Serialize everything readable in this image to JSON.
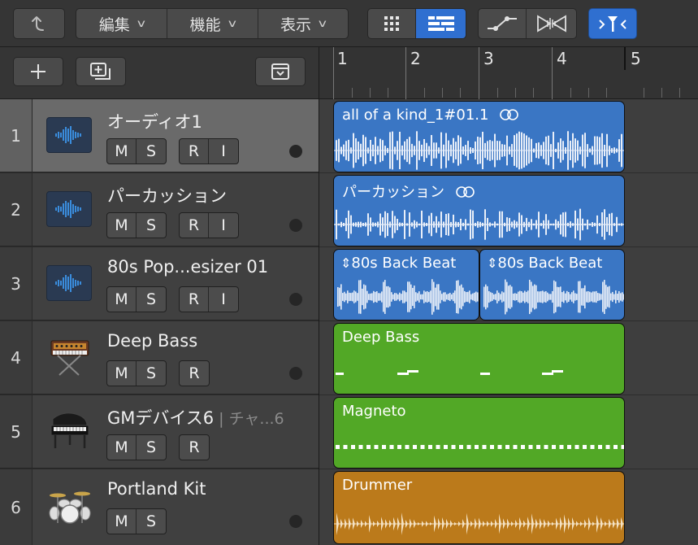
{
  "toolbar": {
    "edit_label": "編集",
    "function_label": "機能",
    "view_label": "表示"
  },
  "ruler": {
    "bars": [
      "1",
      "2",
      "3",
      "4",
      "5"
    ]
  },
  "tracks": [
    {
      "number": "1",
      "name": "オーディオ1",
      "sub": "",
      "buttons": [
        "M",
        "S"
      ],
      "buttons2": [
        "R",
        "I"
      ],
      "type": "audio"
    },
    {
      "number": "2",
      "name": "パーカッション",
      "sub": "",
      "buttons": [
        "M",
        "S"
      ],
      "buttons2": [
        "R",
        "I"
      ],
      "type": "audio"
    },
    {
      "number": "3",
      "name": "80s Pop...esizer 01",
      "sub": "",
      "buttons": [
        "M",
        "S"
      ],
      "buttons2": [
        "R",
        "I"
      ],
      "type": "audio"
    },
    {
      "number": "4",
      "name": "Deep Bass",
      "sub": "",
      "buttons": [
        "M",
        "S"
      ],
      "buttons2": [
        "R"
      ],
      "type": "synth"
    },
    {
      "number": "5",
      "name": "GMデバイス6",
      "sub": " | チャ...6",
      "buttons": [
        "M",
        "S"
      ],
      "buttons2": [
        "R"
      ],
      "type": "piano"
    },
    {
      "number": "6",
      "name": "Portland Kit",
      "sub": "",
      "buttons": [
        "M",
        "S"
      ],
      "buttons2": [],
      "type": "drums"
    }
  ],
  "regions": [
    {
      "name": "all of a kind_1#01.1",
      "color": "#3a76c4"
    },
    {
      "name": "パーカッション",
      "color": "#3a76c4"
    },
    {
      "name": "80s Back Beat",
      "color": "#3a76c4"
    },
    {
      "name": "80s Back Beat",
      "color": "#3a76c4"
    },
    {
      "name": "Deep Bass",
      "color": "#52a826"
    },
    {
      "name": "Magneto",
      "color": "#52a826"
    },
    {
      "name": "Drummer",
      "color": "#bb7a1b"
    }
  ]
}
